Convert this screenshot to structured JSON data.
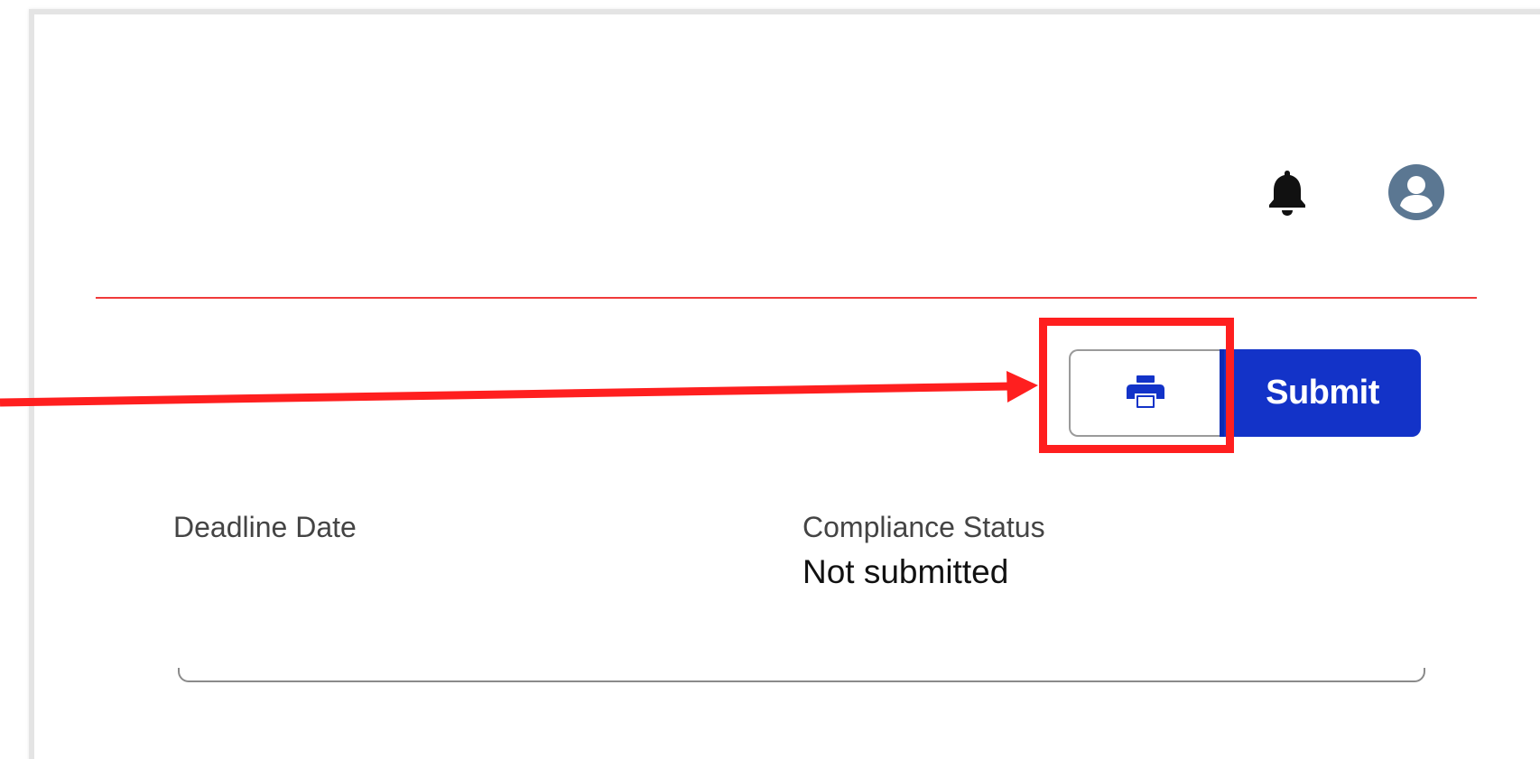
{
  "header": {
    "icons": [
      "bell-icon",
      "user-avatar-icon"
    ],
    "divider_color": "#f03a3a"
  },
  "actions": {
    "print_icon": "printer-icon",
    "submit_label": "Submit",
    "submit_color": "#1333c8",
    "print_icon_color": "#1333c8"
  },
  "annotation": {
    "highlight_color": "#ff1f1f",
    "target": "print-button"
  },
  "fields": {
    "deadline_date": {
      "label": "Deadline Date",
      "value": ""
    },
    "compliance_status": {
      "label": "Compliance Status",
      "value": "Not submitted"
    }
  }
}
